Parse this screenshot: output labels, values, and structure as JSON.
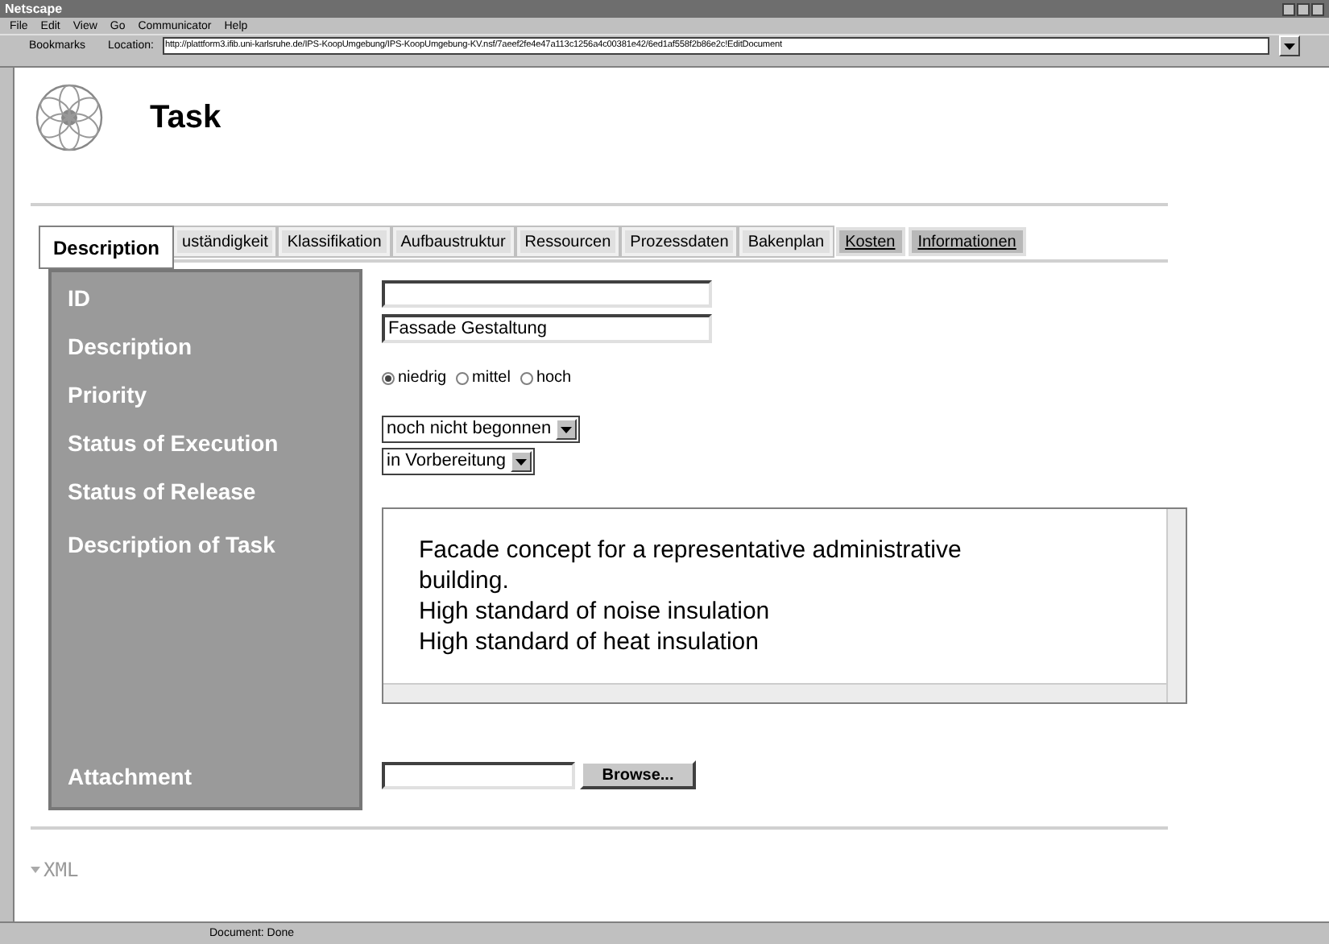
{
  "window": {
    "title": "Netscape"
  },
  "menu": [
    "File",
    "Edit",
    "View",
    "Go",
    "Communicator",
    "Help"
  ],
  "toolbar": {
    "bookmarks": "Bookmarks",
    "location_label": "Location:",
    "url": "http://plattform3.ifib.uni-karlsruhe.de/IPS-KoopUmgebung/IPS-KoopUmgebung-KV.nsf/7aeef2fe4e47a113c1256a4c00381e42/6ed1af558f2b86e2c!EditDocument"
  },
  "page": {
    "title": "Task",
    "tabs": [
      {
        "label": "Description",
        "selected": true,
        "kind": "tab"
      },
      {
        "label": "uständigkeit",
        "selected": false,
        "kind": "tab"
      },
      {
        "label": "Klassifikation",
        "selected": false,
        "kind": "tab"
      },
      {
        "label": "Aufbaustruktur",
        "selected": false,
        "kind": "tab"
      },
      {
        "label": "Ressourcen",
        "selected": false,
        "kind": "tab"
      },
      {
        "label": "Prozessdaten",
        "selected": false,
        "kind": "tab"
      },
      {
        "label": "Bakenplan",
        "selected": false,
        "kind": "tab"
      },
      {
        "label": "Kosten",
        "selected": false,
        "kind": "link"
      },
      {
        "label": "Informationen",
        "selected": false,
        "kind": "link"
      }
    ],
    "labels": [
      "ID",
      "Description",
      "Priority",
      "Status of Execution",
      "Status of Release",
      "Description of Task"
    ],
    "attachment_label": "Attachment",
    "description_value": "Fassade Gestaltung",
    "priority": [
      {
        "label": "niedrig",
        "selected": true
      },
      {
        "label": "mittel",
        "selected": false
      },
      {
        "label": "hoch",
        "selected": false
      }
    ],
    "status_execution": "noch nicht begonnen",
    "status_release": "in Vorbereitung",
    "task_text": "Facade concept for a representative administrative building.\nHigh standard of noise insulation\nHigh standard of heat insulation",
    "browse": "Browse...",
    "xml": "XML"
  },
  "status_bar": "Document: Done"
}
